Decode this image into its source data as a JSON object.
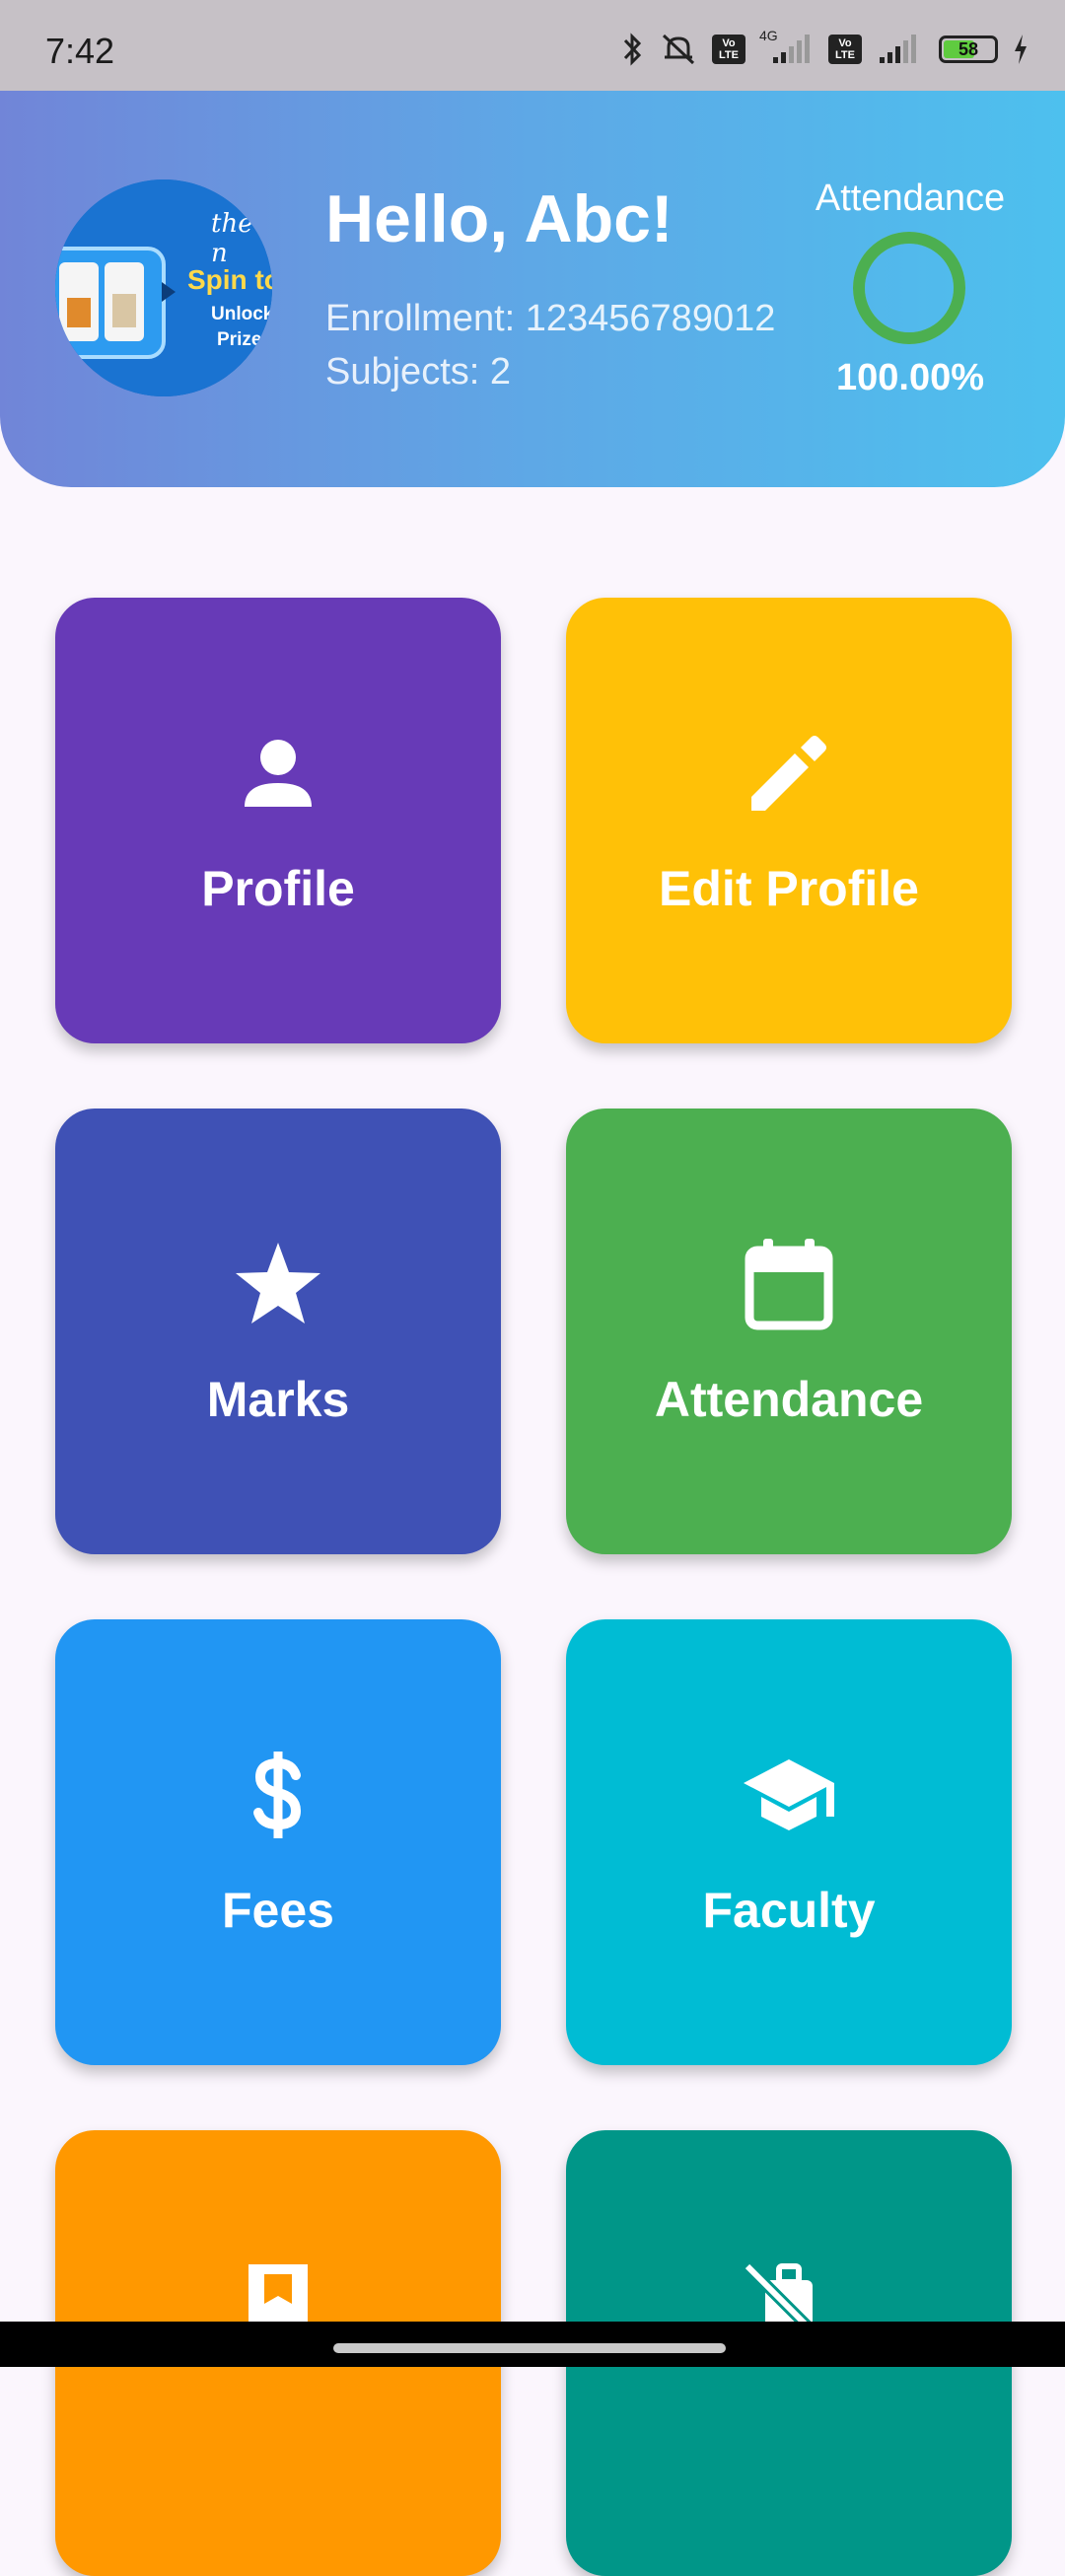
{
  "status_bar": {
    "time": "7:42",
    "network_label": "4G",
    "volte_label": "Vo LTE",
    "battery_level": "58"
  },
  "header": {
    "greeting": "Hello, Abc!",
    "enrollment": "Enrollment: 123456789012",
    "subjects": "Subjects: 2",
    "attendance_title": "Attendance",
    "attendance_percent": "100.00%",
    "attendance_fraction": 1.0,
    "avatar_banner": {
      "line1": "the n",
      "line2": "Spin to",
      "line3": "Unlock",
      "line4": "Prize"
    }
  },
  "tiles": [
    {
      "label": "Profile",
      "color": "#673ab7",
      "icon": "person-icon"
    },
    {
      "label": "Edit Profile",
      "color": "#ffc107",
      "icon": "edit-pencil-icon"
    },
    {
      "label": "Marks",
      "color": "#3f51b5",
      "icon": "star-icon"
    },
    {
      "label": "Attendance",
      "color": "#4caf50",
      "icon": "calendar-icon"
    },
    {
      "label": "Fees",
      "color": "#2196f3",
      "icon": "dollar-icon"
    },
    {
      "label": "Faculty",
      "color": "#00bcd4",
      "icon": "school-icon"
    },
    {
      "label": "",
      "color": "#ff9800",
      "icon": "bookmark-icon"
    },
    {
      "label": "",
      "color": "#009688",
      "icon": "no-luggage-icon"
    }
  ],
  "colors": {
    "background": "#fbf6fd",
    "header_gradient_start": "#7185d8",
    "header_gradient_end": "#4dc0ee",
    "attendance_ring": "#4caf50"
  }
}
